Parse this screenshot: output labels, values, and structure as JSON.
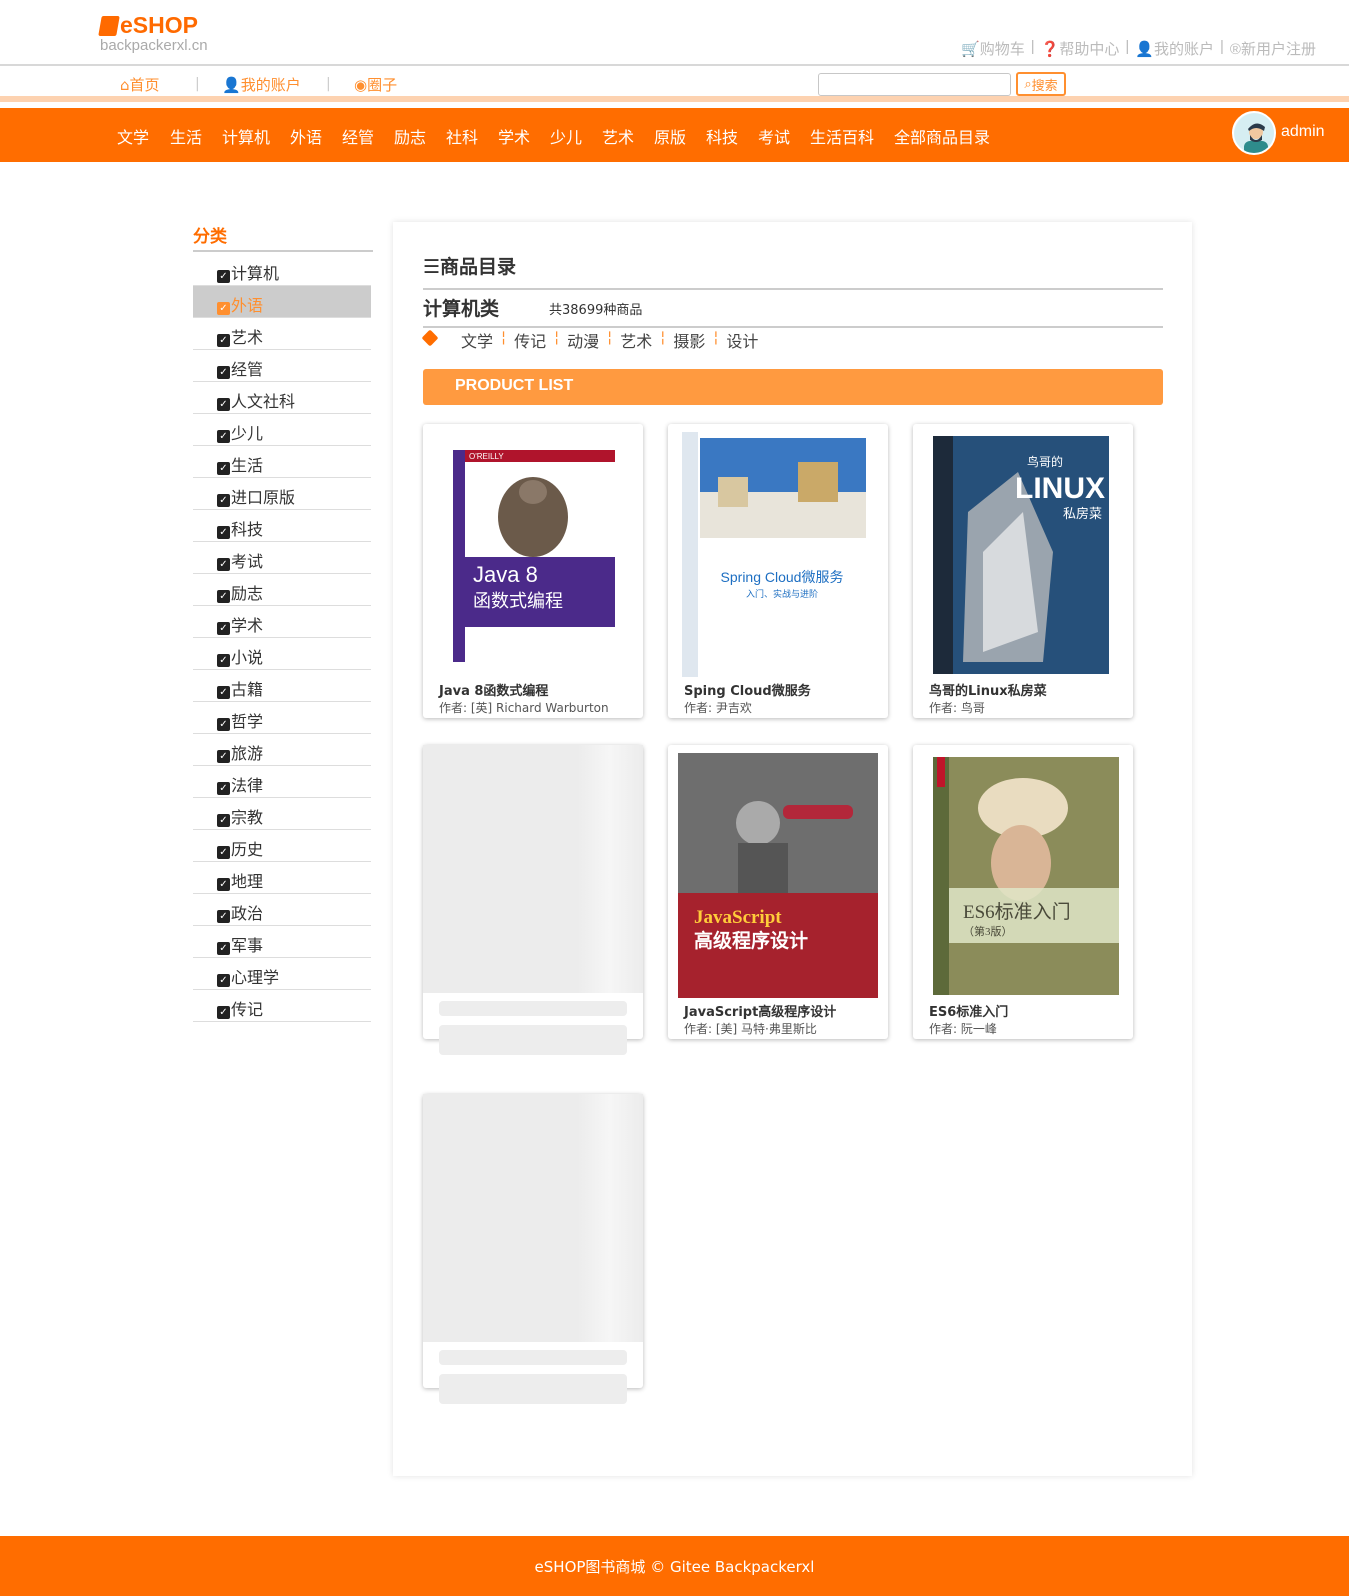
{
  "brand": {
    "logo": "eSHOP",
    "domain": "backpackerxl.cn"
  },
  "top_links": [
    "购物车",
    "帮助中心",
    "我的账户",
    "新用户注册"
  ],
  "subnav": {
    "home": "首页",
    "account": "我的账户",
    "circle": "圈子",
    "search_placeholder": "",
    "search_button": "搜索"
  },
  "categories": [
    "文学",
    "生活",
    "计算机",
    "外语",
    "经管",
    "励志",
    "社科",
    "学术",
    "少儿",
    "艺术",
    "原版",
    "科技",
    "考试",
    "生活百科",
    "全部商品目录"
  ],
  "user": {
    "name": "admin"
  },
  "sidebar": {
    "title": "分类",
    "items": [
      "计算机",
      "外语",
      "艺术",
      "经管",
      "人文社科",
      "少儿",
      "生活",
      "进口原版",
      "科技",
      "考试",
      "励志",
      "学术",
      "小说",
      "古籍",
      "哲学",
      "旅游",
      "法律",
      "宗教",
      "历史",
      "地理",
      "政治",
      "军事",
      "心理学",
      "传记"
    ],
    "active_index": 1
  },
  "main": {
    "title": "商品目录",
    "category": "计算机类",
    "count": "共38699种商品",
    "tags": [
      "文学",
      "传记",
      "动漫",
      "艺术",
      "摄影",
      "设计"
    ],
    "list_header": "PRODUCT LIST",
    "products": [
      {
        "name": "Java 8函数式编程",
        "author": "作者: [英] Richard Warburton",
        "cover_title": "Java 8",
        "cover_sub": "函数式编程",
        "cover_top": "O'REILLY"
      },
      {
        "name": "Sping Cloud微服务",
        "author": "作者: 尹吉欢",
        "cover_title": "Spring Cloud微服务",
        "cover_sub": "入门、实战与进阶"
      },
      {
        "name": "鸟哥的Linux私房菜",
        "author": "作者: 鸟哥",
        "cover_title": "LINUX",
        "cover_sub": "私房菜",
        "cover_top": "鸟哥的"
      },
      {
        "name": "",
        "author": "",
        "loading": true
      },
      {
        "name": "JavaScript高级程序设计",
        "author": "作者: [美] 马特·弗里斯比",
        "cover_title": "JavaScript",
        "cover_sub": "高级程序设计"
      },
      {
        "name": "ES6标准入门",
        "author": "作者: 阮一峰",
        "cover_title": "ES6标准入门",
        "cover_sub": "（第3版）"
      },
      {
        "name": "",
        "author": "",
        "loading": true
      }
    ]
  },
  "footer": "eSHOP图书商城 © Gitee Backpackerxl",
  "colors": {
    "accent": "#ff6d00",
    "accent_light": "#ff9a40",
    "text": "#333333"
  }
}
